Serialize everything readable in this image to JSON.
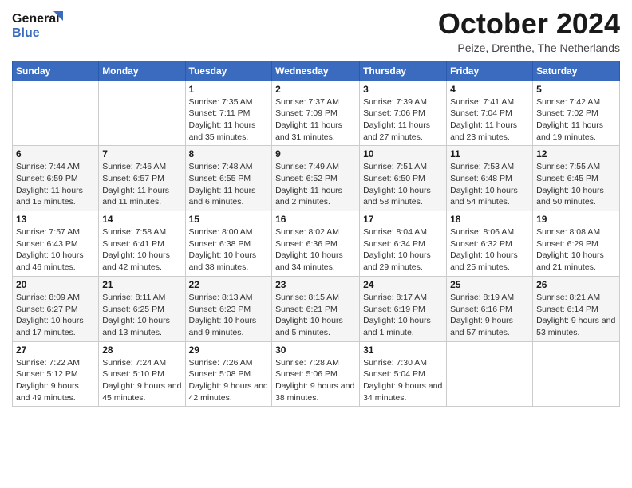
{
  "header": {
    "logo_line1": "General",
    "logo_line2": "Blue",
    "title": "October 2024",
    "location": "Peize, Drenthe, The Netherlands"
  },
  "weekdays": [
    "Sunday",
    "Monday",
    "Tuesday",
    "Wednesday",
    "Thursday",
    "Friday",
    "Saturday"
  ],
  "weeks": [
    [
      {
        "day": "",
        "info": ""
      },
      {
        "day": "",
        "info": ""
      },
      {
        "day": "1",
        "info": "Sunrise: 7:35 AM\nSunset: 7:11 PM\nDaylight: 11 hours and 35 minutes."
      },
      {
        "day": "2",
        "info": "Sunrise: 7:37 AM\nSunset: 7:09 PM\nDaylight: 11 hours and 31 minutes."
      },
      {
        "day": "3",
        "info": "Sunrise: 7:39 AM\nSunset: 7:06 PM\nDaylight: 11 hours and 27 minutes."
      },
      {
        "day": "4",
        "info": "Sunrise: 7:41 AM\nSunset: 7:04 PM\nDaylight: 11 hours and 23 minutes."
      },
      {
        "day": "5",
        "info": "Sunrise: 7:42 AM\nSunset: 7:02 PM\nDaylight: 11 hours and 19 minutes."
      }
    ],
    [
      {
        "day": "6",
        "info": "Sunrise: 7:44 AM\nSunset: 6:59 PM\nDaylight: 11 hours and 15 minutes."
      },
      {
        "day": "7",
        "info": "Sunrise: 7:46 AM\nSunset: 6:57 PM\nDaylight: 11 hours and 11 minutes."
      },
      {
        "day": "8",
        "info": "Sunrise: 7:48 AM\nSunset: 6:55 PM\nDaylight: 11 hours and 6 minutes."
      },
      {
        "day": "9",
        "info": "Sunrise: 7:49 AM\nSunset: 6:52 PM\nDaylight: 11 hours and 2 minutes."
      },
      {
        "day": "10",
        "info": "Sunrise: 7:51 AM\nSunset: 6:50 PM\nDaylight: 10 hours and 58 minutes."
      },
      {
        "day": "11",
        "info": "Sunrise: 7:53 AM\nSunset: 6:48 PM\nDaylight: 10 hours and 54 minutes."
      },
      {
        "day": "12",
        "info": "Sunrise: 7:55 AM\nSunset: 6:45 PM\nDaylight: 10 hours and 50 minutes."
      }
    ],
    [
      {
        "day": "13",
        "info": "Sunrise: 7:57 AM\nSunset: 6:43 PM\nDaylight: 10 hours and 46 minutes."
      },
      {
        "day": "14",
        "info": "Sunrise: 7:58 AM\nSunset: 6:41 PM\nDaylight: 10 hours and 42 minutes."
      },
      {
        "day": "15",
        "info": "Sunrise: 8:00 AM\nSunset: 6:38 PM\nDaylight: 10 hours and 38 minutes."
      },
      {
        "day": "16",
        "info": "Sunrise: 8:02 AM\nSunset: 6:36 PM\nDaylight: 10 hours and 34 minutes."
      },
      {
        "day": "17",
        "info": "Sunrise: 8:04 AM\nSunset: 6:34 PM\nDaylight: 10 hours and 29 minutes."
      },
      {
        "day": "18",
        "info": "Sunrise: 8:06 AM\nSunset: 6:32 PM\nDaylight: 10 hours and 25 minutes."
      },
      {
        "day": "19",
        "info": "Sunrise: 8:08 AM\nSunset: 6:29 PM\nDaylight: 10 hours and 21 minutes."
      }
    ],
    [
      {
        "day": "20",
        "info": "Sunrise: 8:09 AM\nSunset: 6:27 PM\nDaylight: 10 hours and 17 minutes."
      },
      {
        "day": "21",
        "info": "Sunrise: 8:11 AM\nSunset: 6:25 PM\nDaylight: 10 hours and 13 minutes."
      },
      {
        "day": "22",
        "info": "Sunrise: 8:13 AM\nSunset: 6:23 PM\nDaylight: 10 hours and 9 minutes."
      },
      {
        "day": "23",
        "info": "Sunrise: 8:15 AM\nSunset: 6:21 PM\nDaylight: 10 hours and 5 minutes."
      },
      {
        "day": "24",
        "info": "Sunrise: 8:17 AM\nSunset: 6:19 PM\nDaylight: 10 hours and 1 minute."
      },
      {
        "day": "25",
        "info": "Sunrise: 8:19 AM\nSunset: 6:16 PM\nDaylight: 9 hours and 57 minutes."
      },
      {
        "day": "26",
        "info": "Sunrise: 8:21 AM\nSunset: 6:14 PM\nDaylight: 9 hours and 53 minutes."
      }
    ],
    [
      {
        "day": "27",
        "info": "Sunrise: 7:22 AM\nSunset: 5:12 PM\nDaylight: 9 hours and 49 minutes."
      },
      {
        "day": "28",
        "info": "Sunrise: 7:24 AM\nSunset: 5:10 PM\nDaylight: 9 hours and 45 minutes."
      },
      {
        "day": "29",
        "info": "Sunrise: 7:26 AM\nSunset: 5:08 PM\nDaylight: 9 hours and 42 minutes."
      },
      {
        "day": "30",
        "info": "Sunrise: 7:28 AM\nSunset: 5:06 PM\nDaylight: 9 hours and 38 minutes."
      },
      {
        "day": "31",
        "info": "Sunrise: 7:30 AM\nSunset: 5:04 PM\nDaylight: 9 hours and 34 minutes."
      },
      {
        "day": "",
        "info": ""
      },
      {
        "day": "",
        "info": ""
      }
    ]
  ]
}
